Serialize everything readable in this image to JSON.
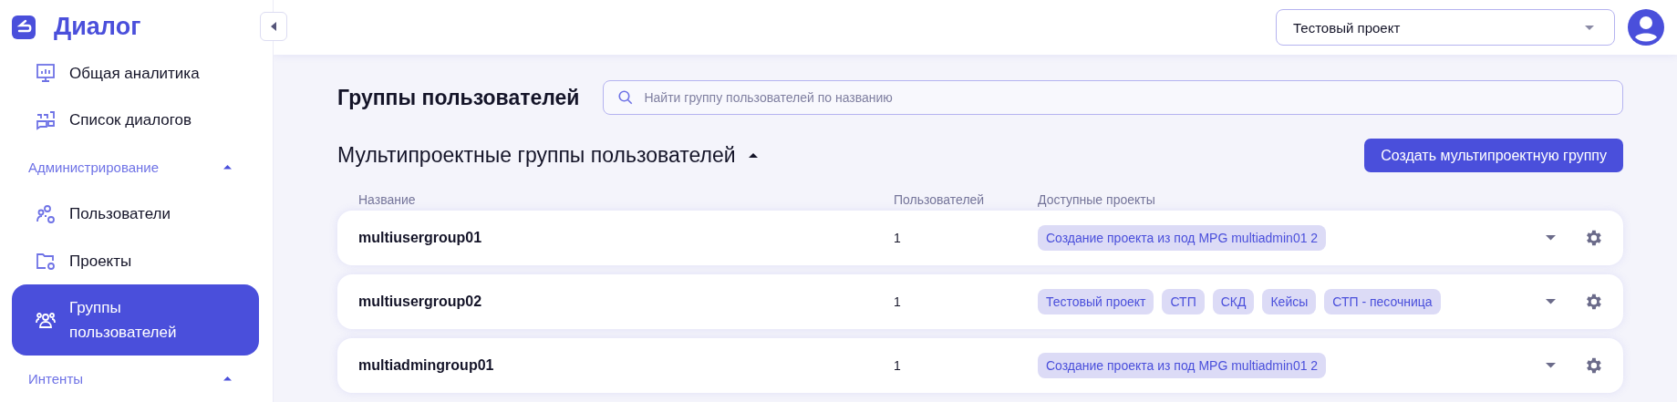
{
  "sidebar": {
    "logo": "Диалог",
    "items": [
      {
        "kind": "item",
        "label": "Общая аналитика",
        "selected": false
      },
      {
        "kind": "item",
        "label": "Список диалогов",
        "selected": false
      },
      {
        "kind": "section",
        "label": "Администрирование",
        "expanded": true
      },
      {
        "kind": "item",
        "label": "Пользователи",
        "selected": false
      },
      {
        "kind": "item",
        "label": "Проекты",
        "selected": false
      },
      {
        "kind": "item",
        "label": "Группы пользователей",
        "selected": true
      },
      {
        "kind": "section",
        "label": "Интенты",
        "expanded": true
      }
    ]
  },
  "topbar": {
    "project_select": "Тестовый проект"
  },
  "page": {
    "title": "Группы пользователей",
    "search": {
      "placeholder": "Найти группу пользователей по названию"
    }
  },
  "section": {
    "title": "Мультипроектные группы пользователей",
    "expanded": true,
    "create_button": "Создать мультипроектную группу"
  },
  "table": {
    "columns": [
      "Название",
      "Пользователей",
      "Доступные проекты"
    ],
    "rows": [
      {
        "name": "multiusergroup01",
        "users": "1",
        "projects": [
          "Создание проекта из под MPG multiadmin01 2"
        ]
      },
      {
        "name": "multiusergroup02",
        "users": "1",
        "projects": [
          "Тестовый проект",
          "СТП",
          "СКД",
          "Кейсы",
          "СТП - песочница"
        ]
      },
      {
        "name": "multiadmingroup01",
        "users": "1",
        "projects": [
          "Создание проекта из под MPG multiadmin01 2"
        ]
      }
    ]
  }
}
